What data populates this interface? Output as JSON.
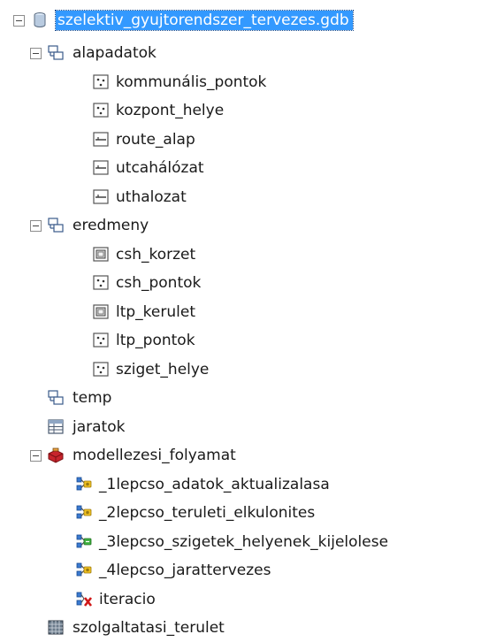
{
  "tree": {
    "root": {
      "label": "szelektiv_gyujtorendszer_tervezes.gdb",
      "icon": "geodatabase-icon"
    },
    "alapadatok": {
      "label": "alapadatok",
      "icon": "feature-dataset-icon",
      "children": [
        {
          "label": "kommunális_pontok",
          "icon": "point-featureclass-icon"
        },
        {
          "label": "kozpont_helye",
          "icon": "point-featureclass-icon"
        },
        {
          "label": "route_alap",
          "icon": "line-featureclass-icon"
        },
        {
          "label": "utcahálózat",
          "icon": "line-featureclass-icon"
        },
        {
          "label": "uthalozat",
          "icon": "line-featureclass-icon"
        }
      ]
    },
    "eredmeny": {
      "label": "eredmeny",
      "icon": "feature-dataset-icon",
      "children": [
        {
          "label": "csh_korzet",
          "icon": "polygon-featureclass-icon"
        },
        {
          "label": "csh_pontok",
          "icon": "point-featureclass-icon"
        },
        {
          "label": "ltp_kerulet",
          "icon": "polygon-featureclass-icon"
        },
        {
          "label": "ltp_pontok",
          "icon": "point-featureclass-icon"
        },
        {
          "label": "sziget_helye",
          "icon": "point-featureclass-icon"
        }
      ]
    },
    "temp": {
      "label": "temp",
      "icon": "feature-dataset-icon"
    },
    "jaratok": {
      "label": "jaratok",
      "icon": "table-icon"
    },
    "modellezesi": {
      "label": "modellezesi_folyamat",
      "icon": "toolbox-icon",
      "children": [
        {
          "label": "_1lepcso_adatok_aktualizalasa",
          "icon": "model-tool-icon"
        },
        {
          "label": "_2lepcso_teruleti_elkulonites",
          "icon": "model-tool-icon"
        },
        {
          "label": "_3lepcso_szigetek_helyenek_kijelolese",
          "icon": "model-tool-icon"
        },
        {
          "label": "_4lepcso_jarattervezes",
          "icon": "model-tool-icon"
        },
        {
          "label": "iteracio",
          "icon": "model-tool-error-icon"
        }
      ]
    },
    "szolgaltatasi": {
      "label": "szolgaltatasi_terulet",
      "icon": "raster-icon"
    }
  }
}
